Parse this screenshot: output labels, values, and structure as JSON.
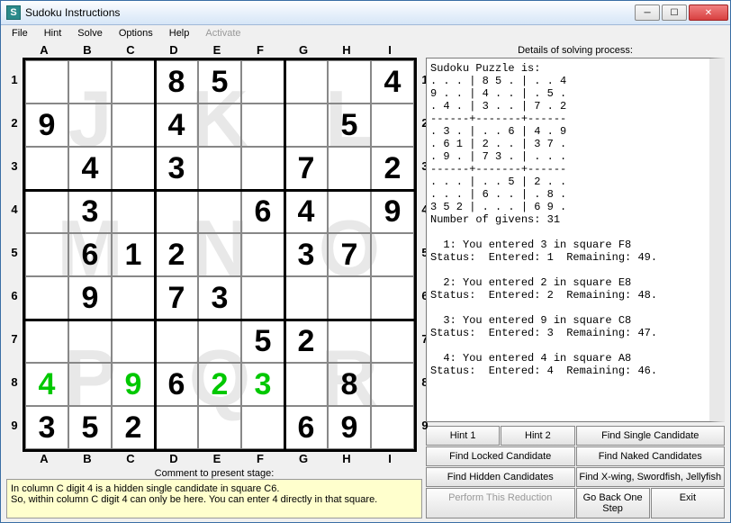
{
  "window": {
    "title": "Sudoku Instructions",
    "icon_letter": "S"
  },
  "menu": {
    "file": "File",
    "hint": "Hint",
    "solve": "Solve",
    "options": "Options",
    "help": "Help",
    "activate": "Activate"
  },
  "columns": [
    "A",
    "B",
    "C",
    "D",
    "E",
    "F",
    "G",
    "H",
    "I"
  ],
  "rows": [
    "1",
    "2",
    "3",
    "4",
    "5",
    "6",
    "7",
    "8",
    "9"
  ],
  "watermarks": [
    "J",
    "K",
    "L",
    "M",
    "N",
    "O",
    "P",
    "Q",
    "R"
  ],
  "grid": [
    [
      {
        "v": "",
        "t": "e"
      },
      {
        "v": "",
        "t": "e"
      },
      {
        "v": "",
        "t": "e"
      },
      {
        "v": "8",
        "t": "g"
      },
      {
        "v": "5",
        "t": "g"
      },
      {
        "v": "",
        "t": "e"
      },
      {
        "v": "",
        "t": "e"
      },
      {
        "v": "",
        "t": "e"
      },
      {
        "v": "4",
        "t": "g"
      }
    ],
    [
      {
        "v": "9",
        "t": "g"
      },
      {
        "v": "",
        "t": "e"
      },
      {
        "v": "",
        "t": "e"
      },
      {
        "v": "4",
        "t": "g"
      },
      {
        "v": "",
        "t": "e"
      },
      {
        "v": "",
        "t": "e"
      },
      {
        "v": "",
        "t": "e"
      },
      {
        "v": "5",
        "t": "g"
      },
      {
        "v": "",
        "t": "e"
      }
    ],
    [
      {
        "v": "",
        "t": "e"
      },
      {
        "v": "4",
        "t": "g"
      },
      {
        "v": "",
        "t": "e"
      },
      {
        "v": "3",
        "t": "g"
      },
      {
        "v": "",
        "t": "e"
      },
      {
        "v": "",
        "t": "e"
      },
      {
        "v": "7",
        "t": "g"
      },
      {
        "v": "",
        "t": "e"
      },
      {
        "v": "2",
        "t": "g"
      }
    ],
    [
      {
        "v": "",
        "t": "e"
      },
      {
        "v": "3",
        "t": "g"
      },
      {
        "v": "",
        "t": "e"
      },
      {
        "v": "",
        "t": "e"
      },
      {
        "v": "",
        "t": "e"
      },
      {
        "v": "6",
        "t": "g"
      },
      {
        "v": "4",
        "t": "g"
      },
      {
        "v": "",
        "t": "e"
      },
      {
        "v": "9",
        "t": "g"
      }
    ],
    [
      {
        "v": "",
        "t": "e"
      },
      {
        "v": "6",
        "t": "g"
      },
      {
        "v": "1",
        "t": "g"
      },
      {
        "v": "2",
        "t": "g"
      },
      {
        "v": "",
        "t": "e"
      },
      {
        "v": "",
        "t": "e"
      },
      {
        "v": "3",
        "t": "g"
      },
      {
        "v": "7",
        "t": "g"
      },
      {
        "v": "",
        "t": "e"
      }
    ],
    [
      {
        "v": "",
        "t": "e"
      },
      {
        "v": "9",
        "t": "g"
      },
      {
        "v": "",
        "t": "e"
      },
      {
        "v": "7",
        "t": "g"
      },
      {
        "v": "3",
        "t": "g"
      },
      {
        "v": "",
        "t": "e"
      },
      {
        "v": "",
        "t": "e"
      },
      {
        "v": "",
        "t": "e"
      },
      {
        "v": "",
        "t": "e"
      }
    ],
    [
      {
        "v": "",
        "t": "e"
      },
      {
        "v": "",
        "t": "e"
      },
      {
        "v": "",
        "t": "e"
      },
      {
        "v": "",
        "t": "e"
      },
      {
        "v": "",
        "t": "e"
      },
      {
        "v": "5",
        "t": "g"
      },
      {
        "v": "2",
        "t": "g"
      },
      {
        "v": "",
        "t": "e"
      },
      {
        "v": "",
        "t": "e"
      }
    ],
    [
      {
        "v": "4",
        "t": "u"
      },
      {
        "v": "",
        "t": "e"
      },
      {
        "v": "9",
        "t": "u"
      },
      {
        "v": "6",
        "t": "g"
      },
      {
        "v": "2",
        "t": "u"
      },
      {
        "v": "3",
        "t": "u"
      },
      {
        "v": "",
        "t": "e"
      },
      {
        "v": "8",
        "t": "g"
      },
      {
        "v": "",
        "t": "e"
      }
    ],
    [
      {
        "v": "3",
        "t": "g"
      },
      {
        "v": "5",
        "t": "g"
      },
      {
        "v": "2",
        "t": "g"
      },
      {
        "v": "",
        "t": "e"
      },
      {
        "v": "",
        "t": "e"
      },
      {
        "v": "",
        "t": "e"
      },
      {
        "v": "6",
        "t": "g"
      },
      {
        "v": "9",
        "t": "g"
      },
      {
        "v": "",
        "t": "e"
      }
    ]
  ],
  "comment": {
    "label": "Comment to present stage:",
    "line1": "In column C digit 4 is a hidden single candidate in square C6.",
    "line2": "So, within column C digit 4 can only be here. You can enter 4 directly in that square."
  },
  "details": {
    "label": "Details of solving process:"
  },
  "log": "Sudoku Puzzle is:\n. . . | 8 5 . | . . 4\n9 . . | 4 . . | . 5 .\n. 4 . | 3 . . | 7 . 2\n------+-------+------\n. 3 . | . . 6 | 4 . 9\n. 6 1 | 2 . . | 3 7 .\n. 9 . | 7 3 . | . . .\n------+-------+------\n. . . | . . 5 | 2 . .\n. . . | 6 . . | . 8 .\n3 5 2 | . . . | 6 9 .\nNumber of givens: 31\n\n  1: You entered 3 in square F8\nStatus:  Entered: 1  Remaining: 49.\n\n  2: You entered 2 in square E8\nStatus:  Entered: 2  Remaining: 48.\n\n  3: You entered 9 in square C8\nStatus:  Entered: 3  Remaining: 47.\n\n  4: You entered 4 in square A8\nStatus:  Entered: 4  Remaining: 46.",
  "buttons": {
    "hint1": "Hint 1",
    "hint2": "Hint 2",
    "single": "Find Single Candidate",
    "locked": "Find Locked Candidate",
    "naked": "Find Naked Candidates",
    "hidden": "Find Hidden Candidates",
    "xwing": "Find X-wing, Swordfish, Jellyfish",
    "reduction": "Perform This Reduction",
    "goback": "Go Back One Step",
    "exit": "Exit"
  }
}
